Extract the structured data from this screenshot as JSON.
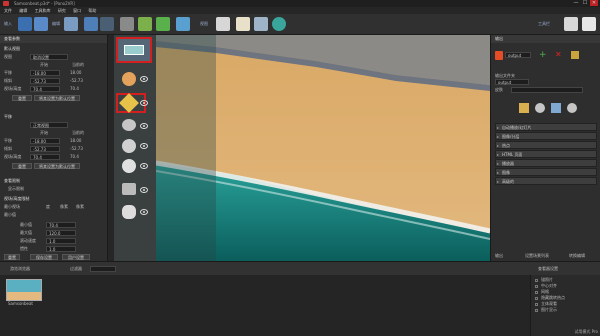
{
  "window": {
    "title": "Samsonbeat.p3d* - [Pano2VR]",
    "minimize": "—",
    "maximize": "☐",
    "close": "✕"
  },
  "menu": [
    "文件",
    "编辑",
    "工具和库",
    "研究",
    "窗口",
    "帮助"
  ],
  "toolbar": {
    "import_label": "输入",
    "edit_label": "编辑",
    "view_label": "视图",
    "tools_label": "工具栏"
  },
  "left_panel": {
    "title": "查看参数",
    "section1": "默认视图",
    "rows": [
      {
        "label": "视图",
        "value": "取消设置"
      },
      {
        "label": "",
        "value": "开始",
        "extra": "当前的"
      },
      {
        "label": "平移",
        "value": "-18.00",
        "extra": "18.00"
      },
      {
        "label": "倾斜",
        "value": "-52.73",
        "extra": "-52.73"
      },
      {
        "label": "视场/高度",
        "value": "70.4",
        "extra": "70.4"
      }
    ],
    "set_button": "重置",
    "current_button": "将其设置为默认位置",
    "section2": "平移",
    "rows2": [
      {
        "label": "",
        "value": "正常视图"
      },
      {
        "label": "",
        "value": "开始",
        "extra": "当前的"
      },
      {
        "label": "平移",
        "value": "-18.00",
        "extra": "18.00"
      },
      {
        "label": "倾斜",
        "value": "-52.73",
        "extra": "-52.73"
      },
      {
        "label": "视场/高度",
        "value": "70.4",
        "extra": "70.4"
      }
    ],
    "set_button2": "重置",
    "current_button2": "将其设置为默认位置",
    "section3": "查看限制",
    "show_limits": "显示限制",
    "section4": "视场/高度限制",
    "fov_min_label": "最小视场",
    "fov_options": [
      "度",
      "像素",
      "像素"
    ],
    "fov_label": "最小值",
    "rows3": [
      {
        "label": "最小值",
        "value": "70.4"
      },
      {
        "label": "最大值",
        "value": "120.0"
      },
      {
        "label": "滚动速度",
        "value": "1.0"
      },
      {
        "label": "惯性",
        "value": "1.0"
      }
    ],
    "reset_btn": "重置",
    "save_btn": "保存设置",
    "user_btn": "用户设置"
  },
  "right_panel": {
    "title": "输出",
    "output_format": "HTML5",
    "output_value": "output",
    "output_folder_label": "输出文件夹",
    "output_folder_value": "output",
    "skin_label": "皮肤",
    "sections": [
      "自动播放/幻灯片",
      "图像/分层",
      "热点",
      "HTML 页面",
      "播放器",
      "图像",
      "高级的"
    ],
    "bottom_tab1": "输出",
    "bottom_tab2": "设置场景列表",
    "bottom_tab3": "转换编辑"
  },
  "bottom_bar": {
    "tour_browser": "游览浏览器",
    "filter_label": "过滤器",
    "properties": "属性"
  },
  "props": {
    "title": "查看器设置",
    "items": [
      "锚照片",
      "中心对齐",
      "网格",
      "隐藏跳转热点",
      "立体观看",
      "图片显示"
    ]
  },
  "status": "试用模式 Pro",
  "thumb": {
    "label": "Samsonbeat"
  },
  "colors": {
    "accent": "#d21f1f",
    "sand": "#d9a865",
    "sea": "#1e8f8a"
  }
}
